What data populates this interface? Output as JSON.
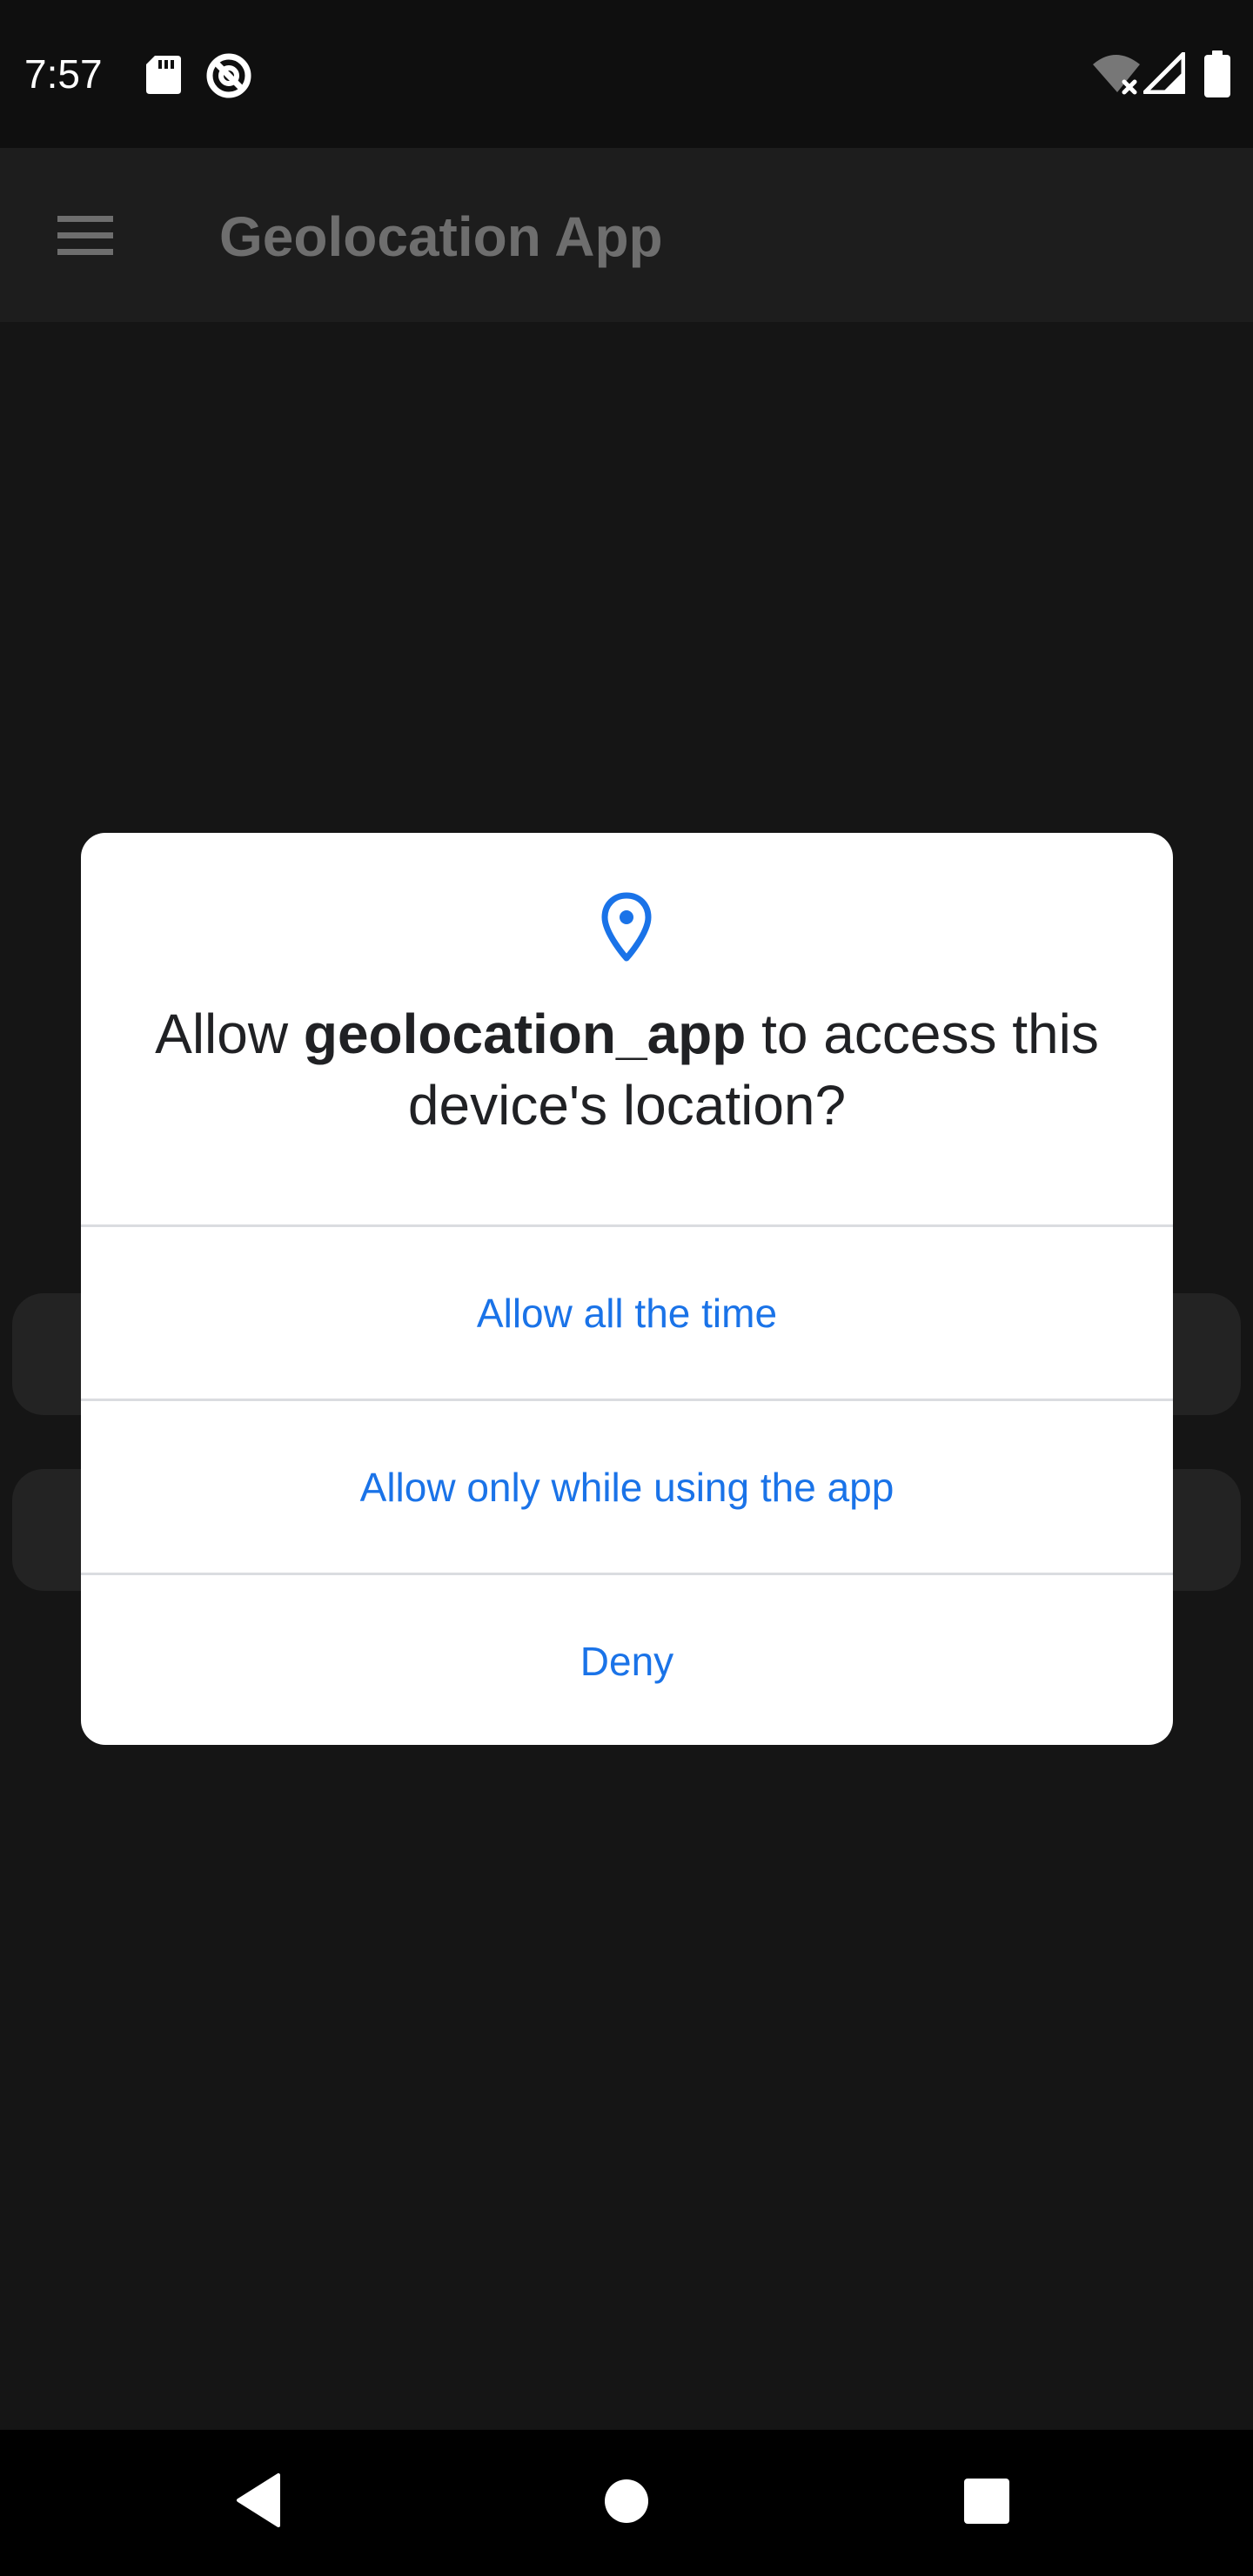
{
  "status_bar": {
    "time": "7:57",
    "left_icons": [
      "sd-card-icon",
      "do-not-disturb-icon"
    ],
    "right_icons": [
      "wifi-no-internet-icon",
      "cellular-signal-icon",
      "battery-icon"
    ]
  },
  "app_bar": {
    "menu_icon": "menu-icon",
    "title": "Geolocation App"
  },
  "dialog": {
    "icon": "location-pin-icon",
    "message_prefix": "Allow ",
    "app_name": "geolocation_app",
    "message_suffix": " to access this device's location?",
    "buttons": {
      "allow_all": "Allow all the time",
      "allow_while_using": "Allow only while using the app",
      "deny": "Deny"
    }
  },
  "nav_bar": {
    "back": "back-icon",
    "home": "home-icon",
    "recents": "recents-icon"
  },
  "colors": {
    "accent": "#1a73e8",
    "background": "#151515",
    "app_bar": "#1d1d1d",
    "dialog": "#ffffff"
  }
}
